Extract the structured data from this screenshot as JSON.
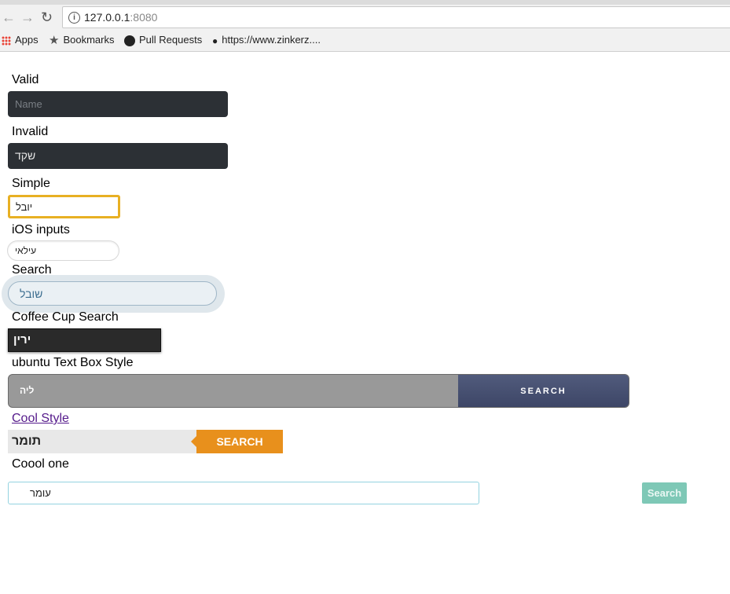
{
  "browser": {
    "url_host": "127.0.0.1",
    "url_port": ":8080",
    "bookmarks": [
      "Apps",
      "Bookmarks",
      "Pull Requests",
      "https://www.zinkerz...."
    ]
  },
  "form": {
    "valid": {
      "label": "Valid",
      "placeholder": "Name"
    },
    "invalid": {
      "label": "Invalid",
      "value": "שקד"
    },
    "simple": {
      "label": "Simple",
      "value": "יובל"
    },
    "ios": {
      "label": "iOS inputs",
      "value": "עילאי"
    },
    "search": {
      "label": "Search",
      "value": "שובל"
    },
    "coffee": {
      "label": "Coffee Cup Search",
      "value": "ירין"
    },
    "ubuntu": {
      "label": "ubuntu Text Box Style",
      "value": "ליה",
      "button": "SEARCH"
    },
    "cool": {
      "label": "Cool Style",
      "value": "תומר",
      "button": "SEARCH"
    },
    "coool": {
      "label": "Coool one",
      "value": "עומר",
      "button": "Search"
    }
  }
}
